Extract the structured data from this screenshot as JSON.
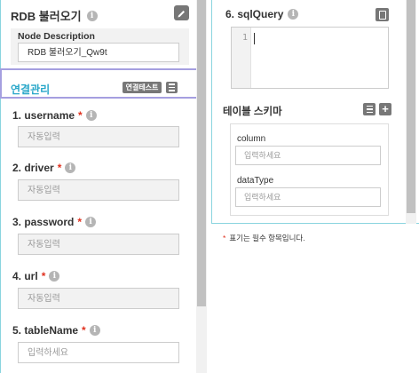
{
  "left": {
    "title": "RDB 불러오기",
    "node_description": {
      "label": "Node Description",
      "value": "RDB 불러오기_Qw9t"
    },
    "connection": {
      "title": "연결관리",
      "test_button": "연결테스트"
    },
    "fields": [
      {
        "label": "1. username",
        "required": "*",
        "placeholder": "자동입력"
      },
      {
        "label": "2. driver",
        "required": "*",
        "placeholder": "자동입력"
      },
      {
        "label": "3. password",
        "required": "*",
        "placeholder": "자동입력"
      },
      {
        "label": "4. url",
        "required": "*",
        "placeholder": "자동입력"
      },
      {
        "label": "5. tableName",
        "required": "*",
        "placeholder": "입력하세요"
      }
    ]
  },
  "right": {
    "sql_query": {
      "label": "6. sqlQuery",
      "line_number": "1"
    },
    "schema": {
      "title": "테이블 스키마",
      "column": {
        "label": "column",
        "placeholder": "입력하세요"
      },
      "data_type": {
        "label": "dataType",
        "placeholder": "입력하세요"
      }
    },
    "required_note": {
      "marker": "*",
      "text": "표기는 필수 항목입니다."
    }
  },
  "icons": {
    "info": "info-icon",
    "edit": "edit-icon",
    "list": "list-icon",
    "add": "plus-icon",
    "sql": "document-icon"
  },
  "colors": {
    "accent_teal": "#29a7c9",
    "highlight_border": "#a59fe0",
    "required": "#e0301e",
    "button_gray": "#777777"
  }
}
